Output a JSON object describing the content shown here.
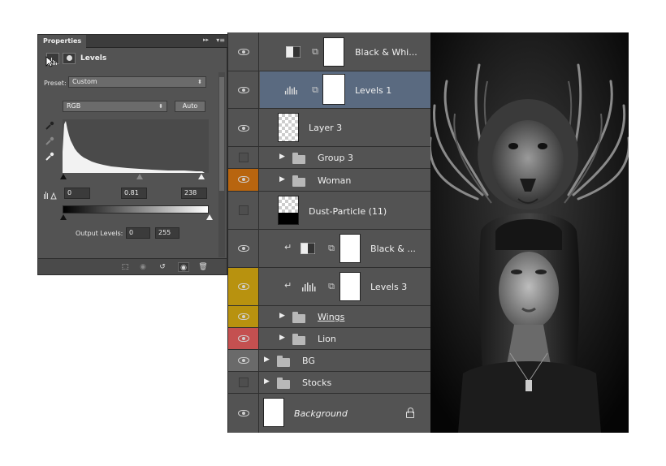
{
  "properties": {
    "tab_label": "Properties",
    "panel_title": "Levels",
    "preset_label": "Preset:",
    "preset_value": "Custom",
    "channel_value": "RGB",
    "auto_label": "Auto",
    "input_black": "0",
    "input_gamma": "0.81",
    "input_white": "238",
    "output_label": "Output Levels:",
    "output_black": "0",
    "output_white": "255",
    "collapse_glyph": "▸▸",
    "menu_glyph": "▾≡"
  },
  "layers": [
    {
      "name": "Black & Whi...",
      "type": "adjustment",
      "adjustment_icon": "black-white-icon",
      "visible": true
    },
    {
      "name": "Levels 1",
      "type": "adjustment",
      "adjustment_icon": "levels-icon",
      "visible": true,
      "selected": true
    },
    {
      "name": "Layer 3",
      "type": "pixel",
      "visible": true
    },
    {
      "name": "Group 3",
      "type": "group",
      "visible": false
    },
    {
      "name": "Woman",
      "type": "group",
      "visible": true,
      "color_label": "#b8650f"
    },
    {
      "name": "Dust-Particle (11)",
      "type": "pixel",
      "visible": false
    },
    {
      "name": "Black & ...",
      "type": "adjustment",
      "adjustment_icon": "black-white-icon",
      "clipped": true,
      "visible": true
    },
    {
      "name": "Levels 3",
      "type": "adjustment",
      "adjustment_icon": "levels-icon",
      "clipped": true,
      "visible": true,
      "color_label": "#b8920f"
    },
    {
      "name": "Wings",
      "type": "group",
      "visible": true,
      "color_label": "#b8920f"
    },
    {
      "name": "Lion",
      "type": "group",
      "visible": true,
      "color_label": "#c45050"
    },
    {
      "name": "BG",
      "type": "group",
      "visible": true,
      "color_label": "#6a6a6a"
    },
    {
      "name": "Stocks",
      "type": "group",
      "visible": false
    },
    {
      "name": "Background",
      "type": "background",
      "visible": true,
      "locked": true
    }
  ],
  "colors": {
    "panel_bg": "#535353",
    "selected_row": "#5a6a80",
    "orange_label": "#b8650f",
    "yellow_label": "#b8920f",
    "red_label": "#c45050",
    "gray_label": "#6a6a6a"
  }
}
